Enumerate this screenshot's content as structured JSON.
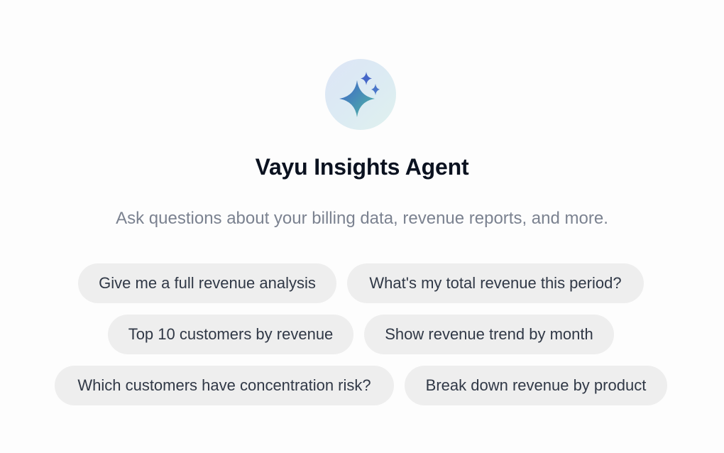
{
  "agent": {
    "icon": "sparkle-icon",
    "title": "Vayu Insights Agent",
    "subtitle": "Ask questions about your billing data, revenue reports, and more."
  },
  "suggestions": [
    "Give me a full revenue analysis",
    "What's my total revenue this period?",
    "Top 10 customers by revenue",
    "Show revenue trend by month",
    "Which customers have concentration risk?",
    "Break down revenue by product"
  ],
  "colors": {
    "title": "#0b1220",
    "subtitle": "#7b8290",
    "chip_background": "#eeeeee",
    "chip_text": "#303846",
    "sparkle_start": "#3f63c9",
    "sparkle_end": "#4fb8a4"
  }
}
